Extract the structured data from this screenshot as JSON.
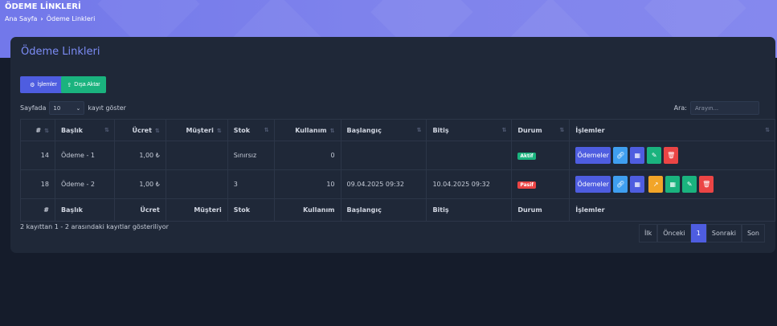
{
  "header": {
    "title": "ÖDEME LİNKLERİ",
    "breadcrumb": [
      "Ana Sayfa",
      "Ödeme Linkleri"
    ]
  },
  "card": {
    "title": "Ödeme Linkleri",
    "buttons": {
      "operations": "İşlemler",
      "export": "Dışa Aktar"
    }
  },
  "length": {
    "prefix": "Sayfada",
    "value": "10",
    "suffix": "kayıt göster"
  },
  "search": {
    "label": "Ara:",
    "placeholder": "Arayın..."
  },
  "table": {
    "columns": [
      "#",
      "Başlık",
      "Ücret",
      "Müşteri",
      "Stok",
      "Kullanım",
      "Başlangıç",
      "Bitiş",
      "Durum",
      "İşlemler"
    ],
    "rows": [
      {
        "id": "14",
        "title": "Ödeme - 1",
        "price": "1,00 ₺",
        "customer": "",
        "stock": "Sınırsız",
        "usage": "0",
        "start": "",
        "end": "",
        "status": "Aktif",
        "pay_label": "Ödemeler"
      },
      {
        "id": "18",
        "title": "Ödeme - 2",
        "price": "1,00 ₺",
        "customer": "",
        "stock": "3",
        "usage": "10",
        "start": "09.04.2025 09:32",
        "end": "10.04.2025 09:32",
        "status": "Pasif",
        "pay_label": "Ödemeler"
      }
    ]
  },
  "info": "2 kayıttan 1 - 2 arasındaki kayıtlar gösteriliyor",
  "pager": {
    "first": "İlk",
    "prev": "Önceki",
    "current": "1",
    "next": "Sonraki",
    "last": "Son"
  },
  "colors": {
    "primary": "#4e5de0",
    "success": "#1ab37e",
    "info": "#3f9ff0",
    "warning": "#f2a528",
    "danger": "#eb4545"
  }
}
